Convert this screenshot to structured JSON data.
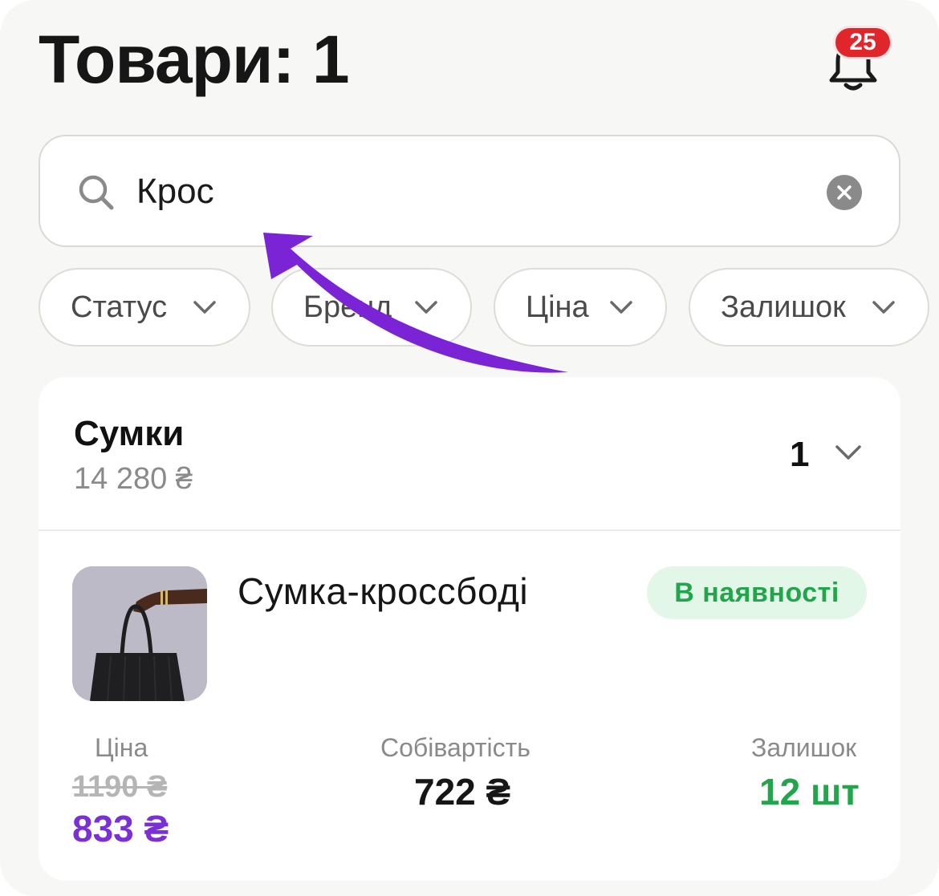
{
  "header": {
    "title": "Товари: 1",
    "notifications_count": "25"
  },
  "search": {
    "value": "Крос"
  },
  "filters": [
    {
      "label": "Статус"
    },
    {
      "label": "Бренд"
    },
    {
      "label": "Ціна"
    },
    {
      "label": "Залишок"
    }
  ],
  "category": {
    "name": "Сумки",
    "total": "14 280 ₴",
    "count": "1"
  },
  "product": {
    "name": "Сумка-кроссбоді",
    "status": "В наявності",
    "price_label": "Ціна",
    "old_price": "1190 ₴",
    "new_price": "833 ₴",
    "cost_label": "Собівартість",
    "cost": "722 ₴",
    "stock_label": "Залишок",
    "stock": "12 шт"
  },
  "colors": {
    "accent_purple": "#7b2fd6",
    "success_green": "#22a54b",
    "badge_red": "#e0262b"
  },
  "icons": [
    "bell-icon",
    "search-icon",
    "clear-icon",
    "chevron-down-icon",
    "arrow-annotation"
  ]
}
